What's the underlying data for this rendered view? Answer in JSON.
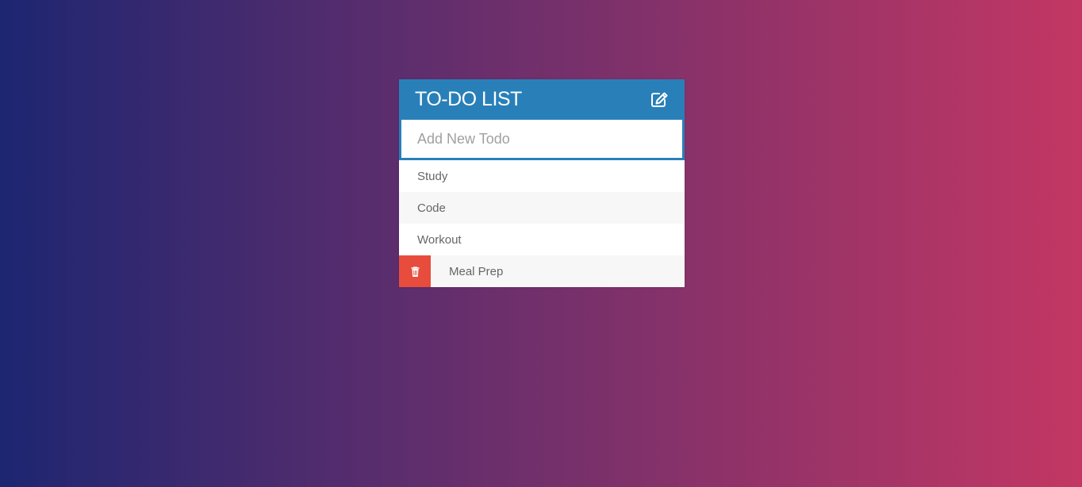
{
  "header": {
    "title": "TO-DO LIST",
    "icon": "edit-icon"
  },
  "input": {
    "placeholder": "Add New Todo",
    "value": ""
  },
  "todos": [
    {
      "text": "Study",
      "hovered": false
    },
    {
      "text": "Code",
      "hovered": false
    },
    {
      "text": "Workout",
      "hovered": false
    },
    {
      "text": "Meal Prep",
      "hovered": true
    }
  ],
  "colors": {
    "header_bg": "#2980b9",
    "delete_bg": "#e74c3c",
    "gradient_start": "#1d2671",
    "gradient_end": "#c33764"
  }
}
